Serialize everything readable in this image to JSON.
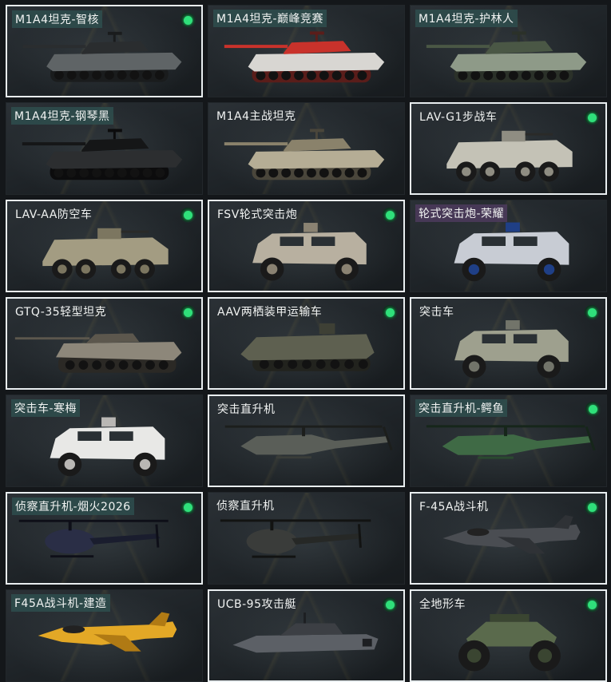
{
  "items": [
    {
      "label": "M1A4坦克-智核",
      "kind": "tank",
      "colors": [
        "#5f6466",
        "#2a2d2f",
        "#1a1c1d"
      ],
      "owned": true,
      "selected": true,
      "tag": "teal"
    },
    {
      "label": "M1A4坦克-巅峰竞赛",
      "kind": "tank",
      "colors": [
        "#d8d6d2",
        "#c9322b",
        "#5a1d1a"
      ],
      "owned": false,
      "selected": false,
      "tag": "teal"
    },
    {
      "label": "M1A4坦克-护林人",
      "kind": "tank",
      "colors": [
        "#8e9a88",
        "#4a5745",
        "#2b3129"
      ],
      "owned": false,
      "selected": false,
      "tag": "teal"
    },
    {
      "label": "M1A4坦克-钢琴黑",
      "kind": "tank",
      "colors": [
        "#2c2e30",
        "#151617",
        "#0c0c0d"
      ],
      "owned": false,
      "selected": false,
      "tag": "teal"
    },
    {
      "label": "M1A4主战坦克",
      "kind": "tank",
      "colors": [
        "#b5ad95",
        "#8a826b",
        "#4a463b"
      ],
      "owned": false,
      "selected": false,
      "tag": "plain"
    },
    {
      "label": "LAV-G1步战车",
      "kind": "apc",
      "colors": [
        "#c4c2b6",
        "#8f8d82",
        "#2a2a28"
      ],
      "owned": true,
      "selected": true,
      "tag": "plain"
    },
    {
      "label": "LAV-AA防空车",
      "kind": "apc",
      "colors": [
        "#a39c82",
        "#7c7660",
        "#2a2a28"
      ],
      "owned": true,
      "selected": true,
      "tag": "plain"
    },
    {
      "label": "FSV轮式突击炮",
      "kind": "mrap",
      "colors": [
        "#b8b0a0",
        "#8a8272",
        "#2a2a28"
      ],
      "owned": true,
      "selected": true,
      "tag": "plain"
    },
    {
      "label": "轮式突击炮-荣耀",
      "kind": "mrap",
      "colors": [
        "#c8ccd4",
        "#1f3f86",
        "#1b1d24"
      ],
      "owned": false,
      "selected": false,
      "tag": "purple"
    },
    {
      "label": "GTQ-35轻型坦克",
      "kind": "lighttank",
      "colors": [
        "#8d877a",
        "#5c574d",
        "#2b2925"
      ],
      "owned": true,
      "selected": true,
      "tag": "plain"
    },
    {
      "label": "AAV两栖装甲运输车",
      "kind": "aav",
      "colors": [
        "#5e6050",
        "#3e4035",
        "#22231e"
      ],
      "owned": true,
      "selected": true,
      "tag": "plain"
    },
    {
      "label": "突击车",
      "kind": "mrap",
      "colors": [
        "#9ea08e",
        "#72746a",
        "#2a2a28"
      ],
      "owned": true,
      "selected": true,
      "tag": "plain"
    },
    {
      "label": "突击车-寒梅",
      "kind": "mrap",
      "colors": [
        "#e8e8e6",
        "#b9b7b4",
        "#2a2a28"
      ],
      "owned": false,
      "selected": false,
      "tag": "teal"
    },
    {
      "label": "突击直升机",
      "kind": "heli",
      "colors": [
        "#5a5e58",
        "#3a3d39",
        "#1c1e1c"
      ],
      "owned": false,
      "selected": true,
      "tag": "plain"
    },
    {
      "label": "突击直升机-鳄鱼",
      "kind": "heli",
      "colors": [
        "#3f6a45",
        "#2a4a2f",
        "#16261a"
      ],
      "owned": true,
      "selected": false,
      "tag": "teal"
    },
    {
      "label": "侦察直升机-烟火2026",
      "kind": "scout",
      "colors": [
        "#2a2e46",
        "#1a1d2e",
        "#0e0f18"
      ],
      "owned": true,
      "selected": true,
      "tag": "teal"
    },
    {
      "label": "侦察直升机",
      "kind": "scout",
      "colors": [
        "#3a3c3a",
        "#262826",
        "#121312"
      ],
      "owned": false,
      "selected": false,
      "tag": "plain"
    },
    {
      "label": "F-45A战斗机",
      "kind": "jet",
      "colors": [
        "#4a4d52",
        "#2f3236",
        "#1a1b1d"
      ],
      "owned": true,
      "selected": true,
      "tag": "plain"
    },
    {
      "label": "F45A战斗机-建造",
      "kind": "jet",
      "colors": [
        "#e3a826",
        "#b07a14",
        "#1c1a16"
      ],
      "owned": false,
      "selected": false,
      "tag": "teal"
    },
    {
      "label": "UCB-95攻击艇",
      "kind": "boat",
      "colors": [
        "#5c6066",
        "#3c3f44",
        "#1d1f22"
      ],
      "owned": true,
      "selected": true,
      "tag": "plain"
    },
    {
      "label": "全地形车",
      "kind": "atv",
      "colors": [
        "#5a6a4c",
        "#3a4531",
        "#151613"
      ],
      "owned": true,
      "selected": true,
      "tag": "plain"
    }
  ]
}
